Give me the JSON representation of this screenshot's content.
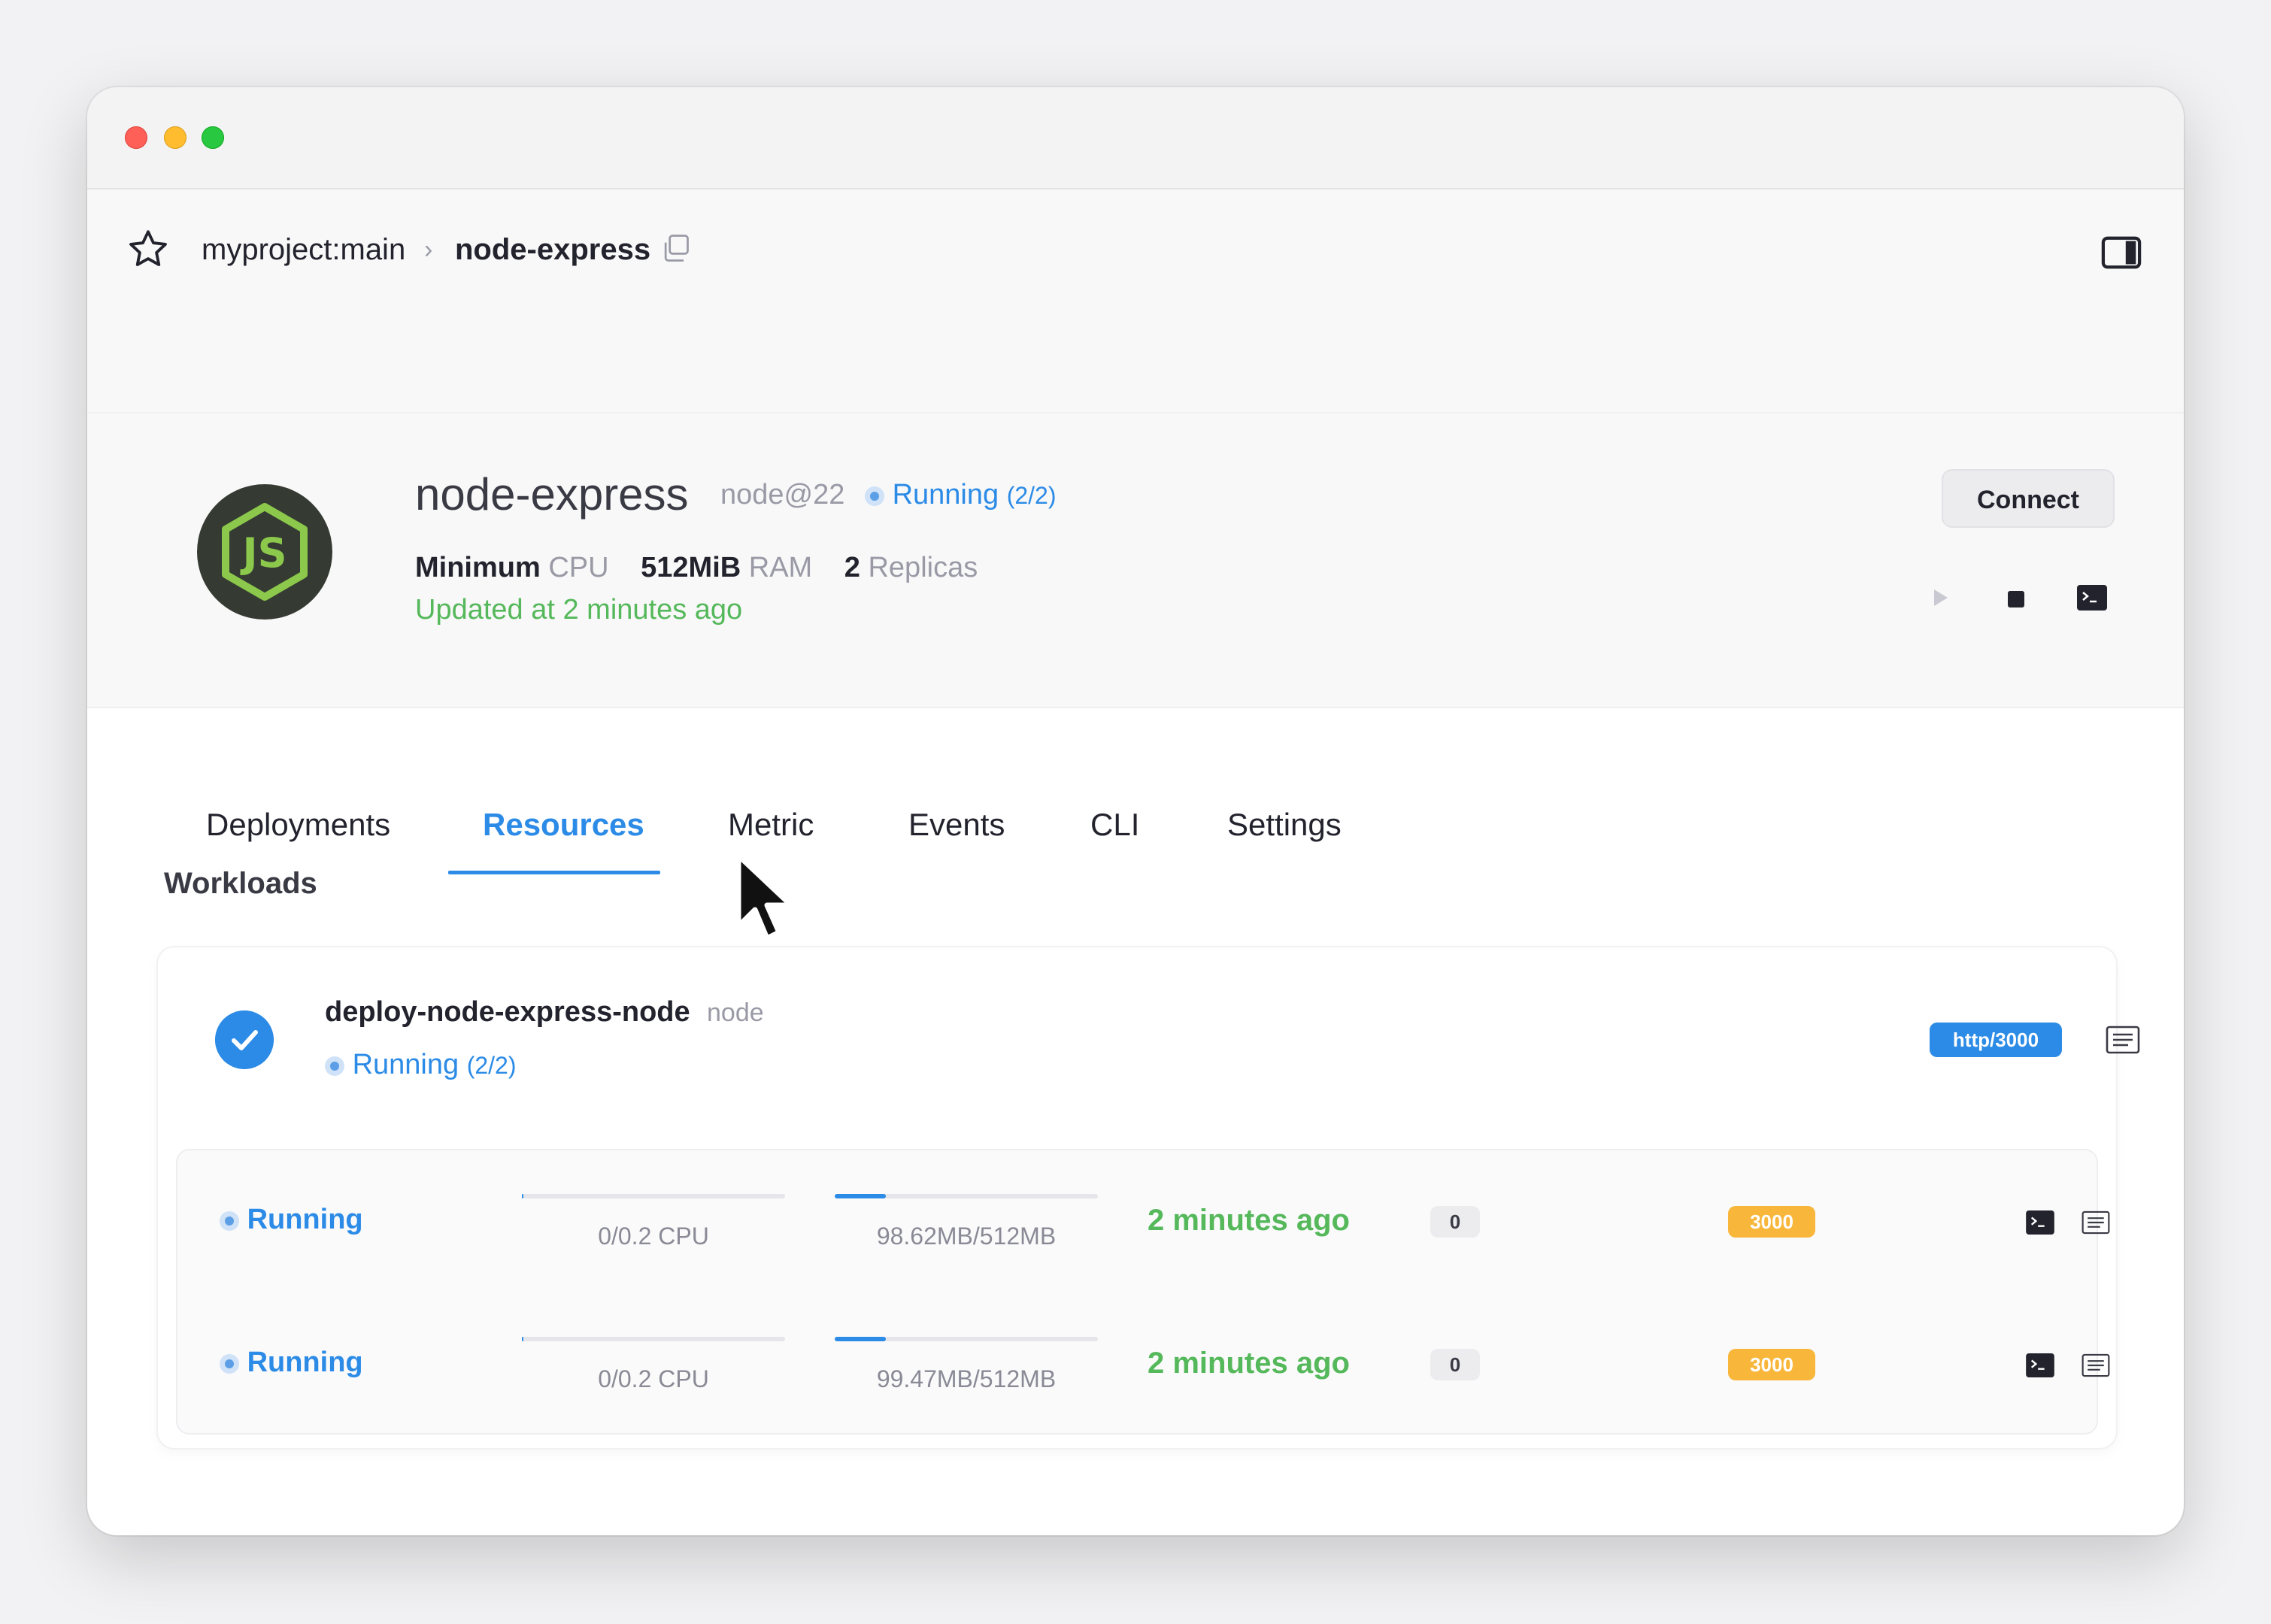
{
  "breadcrumb": {
    "project": "myproject:main",
    "separator": "›",
    "service": "node-express"
  },
  "service": {
    "name": "node-express",
    "version": "node@22",
    "status": "Running",
    "status_count": "(2/2)",
    "cpu_value": "Minimum",
    "cpu_unit": "CPU",
    "ram_value": "512MiB",
    "ram_unit": "RAM",
    "replicas_value": "2",
    "replicas_unit": "Replicas",
    "updated": "Updated at 2 minutes ago",
    "connect_label": "Connect"
  },
  "tabs": [
    {
      "label": "Deployments",
      "active": false
    },
    {
      "label": "Resources",
      "active": true
    },
    {
      "label": "Metric",
      "active": false
    },
    {
      "label": "Events",
      "active": false
    },
    {
      "label": "CLI",
      "active": false
    },
    {
      "label": "Settings",
      "active": false
    }
  ],
  "workloads": {
    "section_title": "Workloads",
    "name": "deploy-node-express-node",
    "type": "node",
    "status": "Running",
    "status_count": "(2/2)",
    "endpoint": "http/3000",
    "pods": [
      {
        "status": "Running",
        "cpu_label": "0/0.2 CPU",
        "cpu_fraction": 0.0,
        "mem_label": "98.62MB/512MB",
        "mem_fraction": 0.193,
        "age": "2 minutes ago",
        "restarts": "0",
        "port": "3000"
      },
      {
        "status": "Running",
        "cpu_label": "0/0.2 CPU",
        "cpu_fraction": 0.0,
        "mem_label": "99.47MB/512MB",
        "mem_fraction": 0.194,
        "age": "2 minutes ago",
        "restarts": "0",
        "port": "3000"
      }
    ]
  },
  "colors": {
    "accent": "#2b8be6",
    "success": "#55b85a",
    "port_badge": "#f8b63a",
    "node_logo_bg": "#353b33",
    "node_logo_fg": "#8cc84b"
  }
}
